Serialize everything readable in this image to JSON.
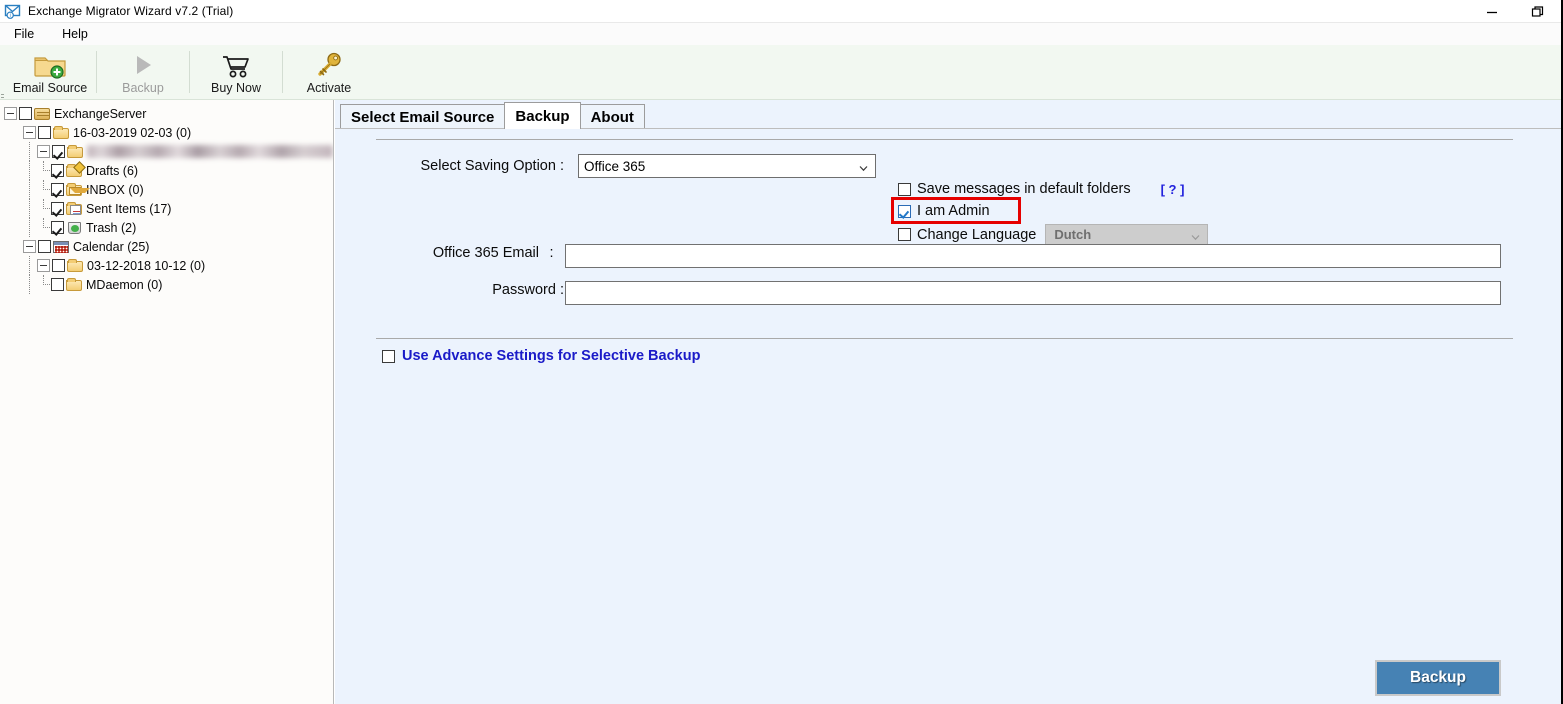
{
  "window": {
    "title": "Exchange Migrator Wizard v7.2 (Trial)",
    "icon": "envelope-app-icon",
    "minimize_label": "—",
    "restore_label": "❐"
  },
  "menubar": {
    "items": [
      {
        "label": "File",
        "name": "menu-file"
      },
      {
        "label": "Help",
        "name": "menu-help"
      }
    ]
  },
  "toolbar": {
    "buttons": [
      {
        "label": "Email Source",
        "icon": "folder-add-icon",
        "enabled": true
      },
      {
        "label": "Backup",
        "icon": "play-triangle-icon",
        "enabled": false
      },
      {
        "label": "Buy Now",
        "icon": "shopping-cart-icon",
        "enabled": true
      },
      {
        "label": "Activate",
        "icon": "key-icon",
        "enabled": true
      }
    ]
  },
  "sidebar": {
    "tree": [
      {
        "label": "ExchangeServer",
        "icon": "server-stack-icon",
        "checked": false,
        "expander": "minus",
        "depth": 0
      },
      {
        "label": "16-03-2019 02-03 (0)",
        "icon": "folder-icon",
        "checked": false,
        "expander": "minus",
        "depth": 1
      },
      {
        "label": "",
        "icon": "folder-icon",
        "checked": true,
        "expander": "minus",
        "depth": 2,
        "redacted": true
      },
      {
        "label": "Drafts (6)",
        "icon": "folder-drafts-icon",
        "checked": true,
        "expander": "none",
        "depth": 3
      },
      {
        "label": "INBOX (0)",
        "icon": "folder-inbox-icon",
        "checked": true,
        "expander": "none",
        "depth": 3
      },
      {
        "label": "Sent Items (17)",
        "icon": "folder-sent-icon",
        "checked": true,
        "expander": "none",
        "depth": 3
      },
      {
        "label": "Trash (2)",
        "icon": "folder-trash-icon",
        "checked": true,
        "expander": "none",
        "depth": 3
      },
      {
        "label": "Calendar (25)",
        "icon": "calendar-icon",
        "checked": false,
        "expander": "minus",
        "depth": 1
      },
      {
        "label": "03-12-2018 10-12 (0)",
        "icon": "folder-icon",
        "checked": false,
        "expander": "minus",
        "depth": 2
      },
      {
        "label": "MDaemon (0)",
        "icon": "folder-icon",
        "checked": false,
        "expander": "none",
        "depth": 3
      }
    ]
  },
  "main": {
    "tabs": [
      {
        "label": "Select Email Source",
        "active": false
      },
      {
        "label": "Backup",
        "active": true
      },
      {
        "label": "About",
        "active": false
      }
    ],
    "form": {
      "saving_option_label": "Select Saving Option :",
      "saving_option_value": "Office 365",
      "saving_option_choices": [
        "Office 365"
      ],
      "save_default_folders_label": "Save messages in default folders",
      "save_default_folders_checked": false,
      "help_link_label": "[ ? ]",
      "i_am_admin_label": "I am Admin",
      "i_am_admin_checked": true,
      "change_language_label": "Change Language",
      "change_language_checked": false,
      "language_value": "Dutch",
      "email_label": "Office 365 Email",
      "email_label_colon": ":",
      "email_value": "",
      "email_placeholder": "",
      "password_label": "Password :",
      "password_value": "",
      "password_placeholder": ""
    },
    "advance": {
      "label": "Use Advance Settings for Selective Backup",
      "checked": false
    },
    "primary_button": "Backup"
  },
  "colors": {
    "panel_bg": "#ecf3fd",
    "toolbar_bg": "#f2f8f1",
    "sidebar_bg": "#fdfcfa",
    "accent_button": "#4682b4",
    "link_blue": "#2222dd",
    "advance_blue": "#1a1ac8",
    "highlight_red": "#e60000",
    "checkbox_check_blue": "#2178c8"
  }
}
